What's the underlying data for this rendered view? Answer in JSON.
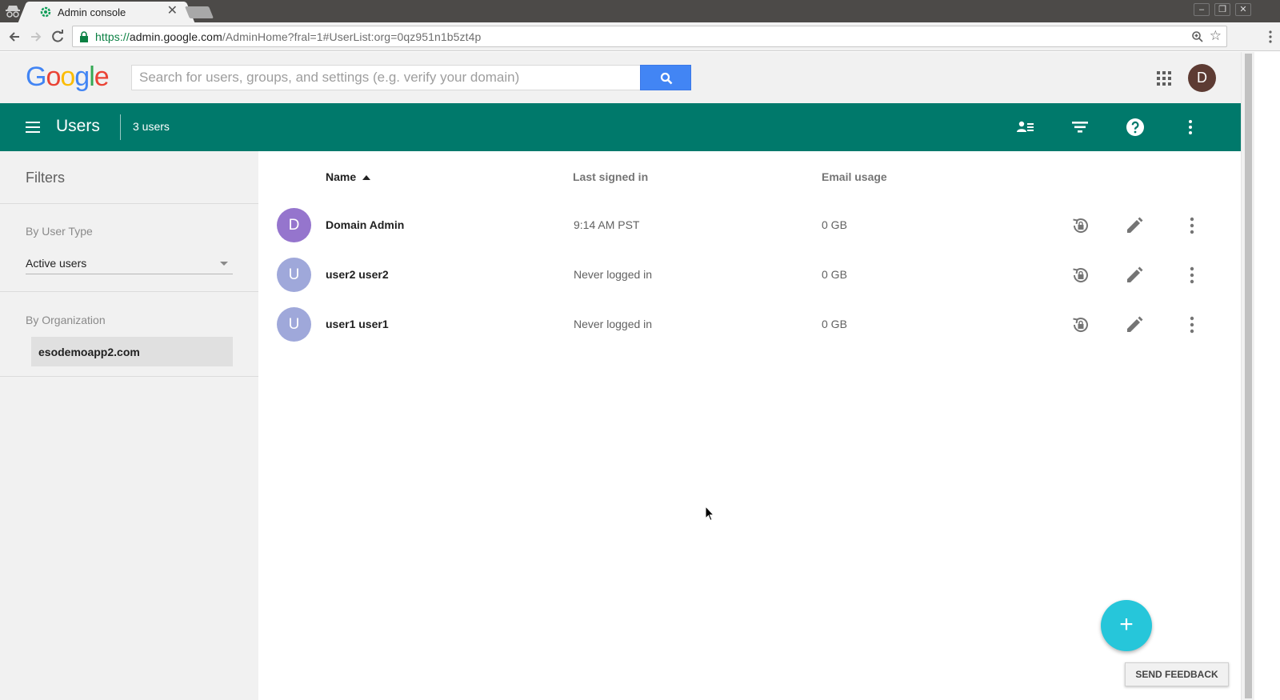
{
  "browser": {
    "tab_title": "Admin console",
    "tab_close": "✕",
    "url_scheme": "https://",
    "url_host": "admin.google.com",
    "url_path": "/AdminHome?fral=1#UserList:org=0qz951n1b5zt4p",
    "star": "☆"
  },
  "header": {
    "logo": [
      "G",
      "o",
      "o",
      "g",
      "l",
      "e"
    ],
    "logo_colors": [
      "#4285f4",
      "#ea4335",
      "#fbbc05",
      "#4285f4",
      "#34a853",
      "#ea4335"
    ],
    "search_placeholder": "Search for users, groups, and settings (e.g. verify your domain)",
    "account_initial": "D"
  },
  "appbar": {
    "title": "Users",
    "count": "3 users",
    "color": "#00796b"
  },
  "sidebar": {
    "title": "Filters",
    "user_type_label": "By User Type",
    "user_type_value": "Active users",
    "org_label": "By Organization",
    "org_value": "esodemoapp2.com"
  },
  "table": {
    "columns": [
      "Name",
      "Last signed in",
      "Email usage"
    ],
    "rows": [
      {
        "initial": "D",
        "avatar_color": "#9575cd",
        "name": "Domain Admin",
        "last_signed_in": "9:14 AM PST",
        "email_usage": "0 GB"
      },
      {
        "initial": "U",
        "avatar_color": "#9fa8da",
        "name": "user2 user2",
        "last_signed_in": "Never logged in",
        "email_usage": "0 GB"
      },
      {
        "initial": "U",
        "avatar_color": "#9fa8da",
        "name": "user1 user1",
        "last_signed_in": "Never logged in",
        "email_usage": "0 GB"
      }
    ]
  },
  "fab_label": "+",
  "feedback_label": "SEND FEEDBACK"
}
